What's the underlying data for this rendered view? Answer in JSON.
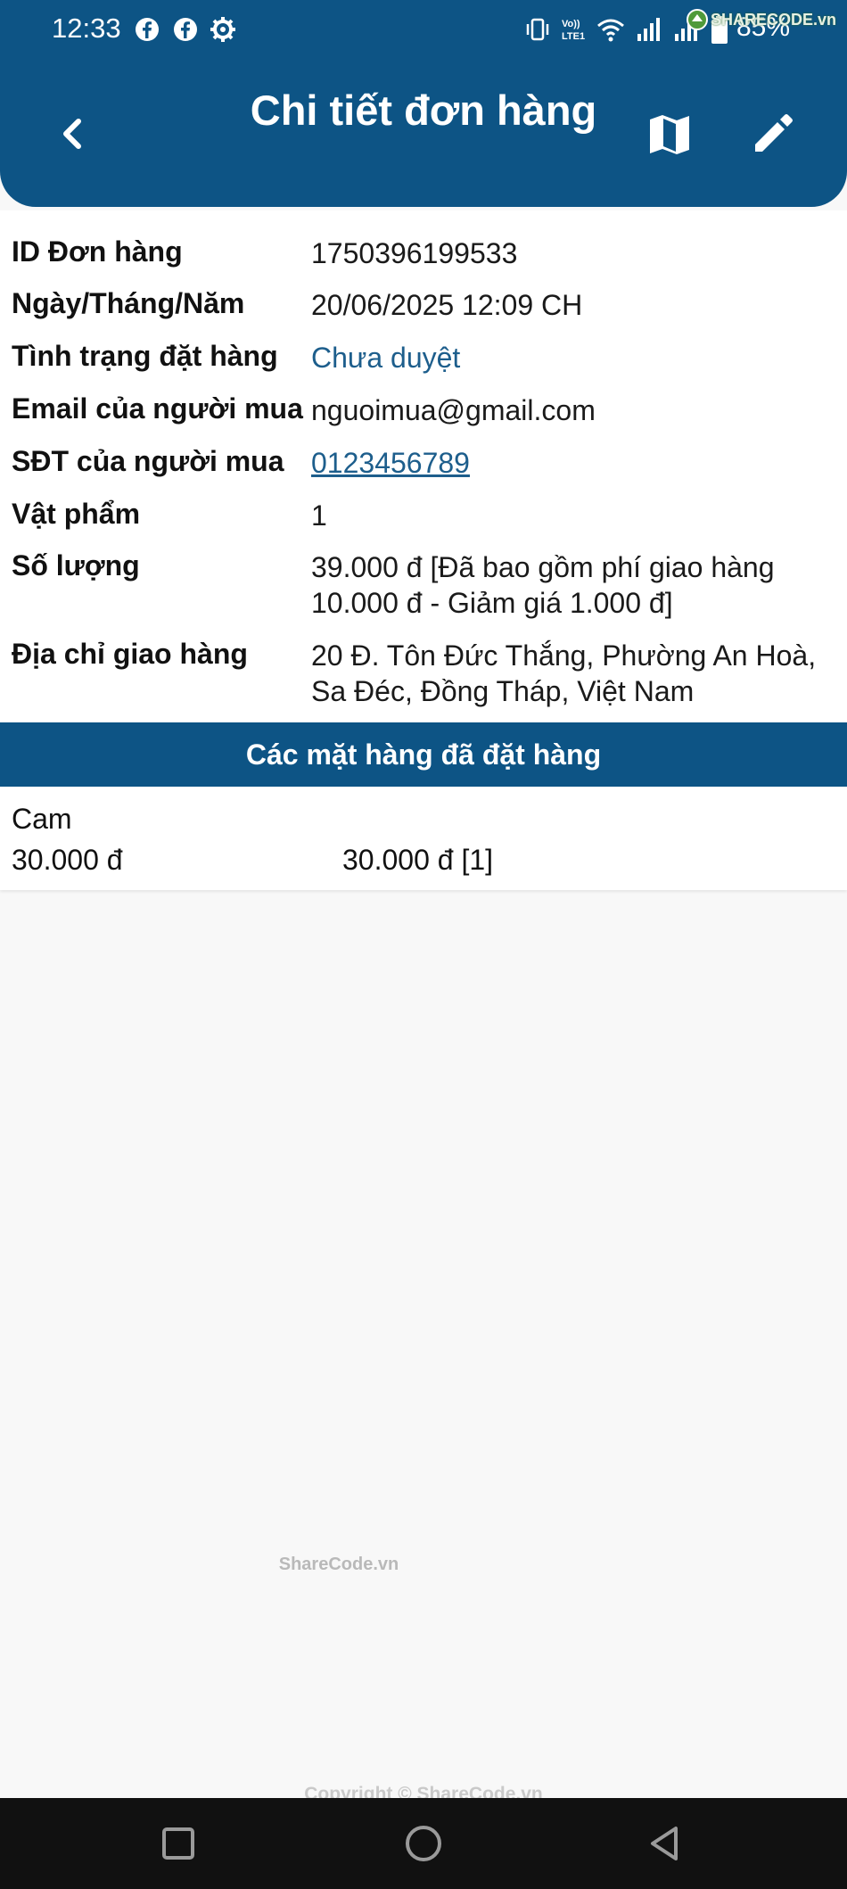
{
  "status_bar": {
    "time": "12:33",
    "battery": "85%",
    "watermark": "SHARECODE.vn",
    "icons": [
      "facebook-icon",
      "facebook-icon",
      "settings-icon",
      "vibrate-icon",
      "volte-icon",
      "wifi-icon",
      "signal-icon",
      "signal-icon",
      "battery-icon"
    ]
  },
  "header": {
    "title": "Chi tiết đơn hàng",
    "back_icon": "chevron-left-icon",
    "map_icon": "map-icon",
    "edit_icon": "pencil-icon",
    "bg_color": "#0d5485"
  },
  "order": {
    "rows": [
      {
        "label": "ID Đơn hàng",
        "value": "1750396199533"
      },
      {
        "label": "Ngày/Tháng/Năm",
        "value": "20/06/2025 12:09 CH"
      },
      {
        "label": "Tình trạng đặt hàng",
        "value": "Chưa duyệt"
      },
      {
        "label": "Email của người mua",
        "value": "nguoimua@gmail.com"
      },
      {
        "label": "SĐT của người mua",
        "value": "0123456789"
      },
      {
        "label": "Vật phẩm",
        "value": "1"
      },
      {
        "label": "Số lượng",
        "value": "39.000 đ [Đã bao gồm phí giao hàng 10.000 đ - Giảm giá 1.000 đ]"
      },
      {
        "label": "Địa chỉ giao hàng",
        "value": "20 Đ. Tôn Đức Thắng, Phường An Hoà, Sa Đéc, Đồng Tháp, Việt Nam"
      }
    ],
    "status_color": "#1d5e8c"
  },
  "items_section": {
    "title": "Các mặt hàng đã đặt hàng",
    "items": [
      {
        "name": "Cam",
        "price": "30.000 đ",
        "total": "30.000 đ [1]"
      }
    ]
  },
  "watermark_mid": "ShareCode.vn",
  "copyright": "Copyright © ShareCode.vn",
  "nav": {
    "icons": [
      "square-icon",
      "circle-icon",
      "triangle-back-icon"
    ]
  }
}
